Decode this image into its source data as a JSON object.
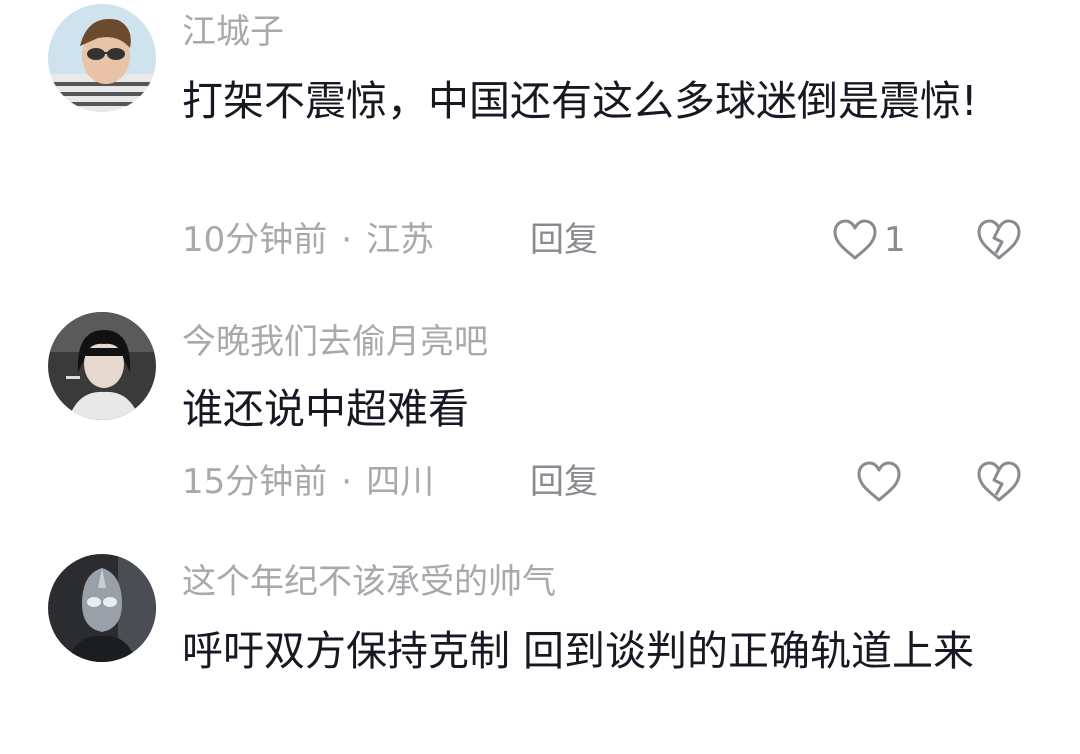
{
  "comments": [
    {
      "username": "江城子",
      "text": "打架不震惊，中国还有这么多球迷倒是震惊!",
      "time": "10分钟前",
      "separator": "·",
      "location": "江苏",
      "reply_label": "回复",
      "like_count": "1",
      "avatar_icon": "avatar-man-sunglasses"
    },
    {
      "username": "今晚我们去偷月亮吧",
      "text": "谁还说中超难看",
      "time": "15分钟前",
      "separator": "·",
      "location": "四川",
      "reply_label": "回复",
      "like_count": "",
      "avatar_icon": "avatar-woman-dark-hair"
    },
    {
      "username": "这个年纪不该承受的帅气",
      "text": "呼吁双方保持克制 回到谈判的正确轨道上来",
      "avatar_icon": "avatar-ultraman-dark"
    }
  ],
  "icons": {
    "like": "heart-outline-icon",
    "dislike": "broken-heart-icon"
  },
  "colors": {
    "text": "#161823",
    "muted": "#a8a9ad",
    "icon": "#8a8b90"
  }
}
